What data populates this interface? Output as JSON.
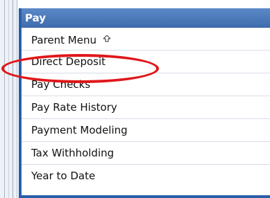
{
  "panel": {
    "title": "Pay",
    "items": [
      {
        "label": "Parent Menu",
        "icon": "up-arrow-icon"
      },
      {
        "label": "Direct Deposit"
      },
      {
        "label": "Pay Checks"
      },
      {
        "label": "Pay Rate History"
      },
      {
        "label": "Payment Modeling"
      },
      {
        "label": "Tax Withholding"
      },
      {
        "label": "Year to Date"
      }
    ],
    "highlighted_item": "Direct Deposit"
  },
  "colors": {
    "header": "#3f6eae",
    "highlight_ring": "#e0171a",
    "border": "#2a5ea8"
  }
}
